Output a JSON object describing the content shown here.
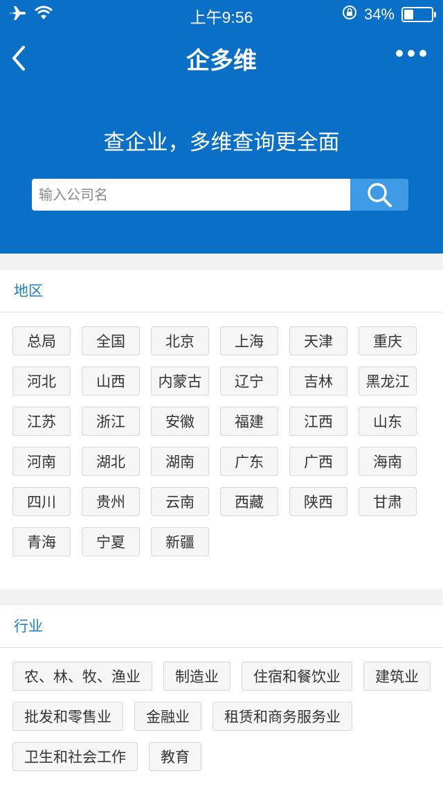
{
  "status_bar": {
    "time": "上午9:56",
    "battery": "34%",
    "battery_level": 0.34
  },
  "nav": {
    "title": "企多维"
  },
  "hero": {
    "slogan": "查企业，多维查询更全面"
  },
  "search": {
    "placeholder": "输入公司名",
    "value": ""
  },
  "region": {
    "title": "地区",
    "items": [
      "总局",
      "全国",
      "北京",
      "上海",
      "天津",
      "重庆",
      "河北",
      "山西",
      "内蒙古",
      "辽宁",
      "吉林",
      "黑龙江",
      "江苏",
      "浙江",
      "安徽",
      "福建",
      "江西",
      "山东",
      "河南",
      "湖北",
      "湖南",
      "广东",
      "广西",
      "海南",
      "四川",
      "贵州",
      "云南",
      "西藏",
      "陕西",
      "甘肃",
      "青海",
      "宁夏",
      "新疆"
    ]
  },
  "industry": {
    "title": "行业",
    "items": [
      "农、林、牧、渔业",
      "制造业",
      "住宿和餐饮业",
      "建筑业",
      "批发和零售业",
      "金融业",
      "租赁和商务服务业",
      "卫生和社会工作",
      "教育"
    ]
  },
  "colors": {
    "primary": "#0a6fc6",
    "search_button": "#3f9be6",
    "section_title": "#1a7fd1"
  }
}
